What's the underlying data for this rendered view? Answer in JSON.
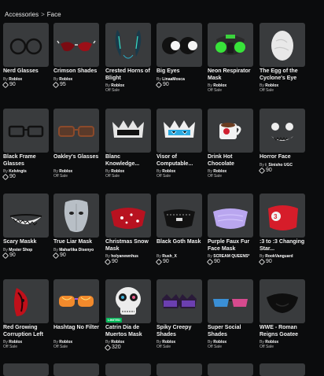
{
  "breadcrumb": {
    "parent": "Accessories",
    "separator": ">",
    "current": "Face"
  },
  "items": [
    {
      "name": "Nerd Glasses",
      "by_prefix": "By",
      "creator": "Roblox",
      "price": "90",
      "icon": "glasses-icon"
    },
    {
      "name": "Crimson Shades",
      "by_prefix": "By",
      "creator": "Roblox",
      "price": "95",
      "icon": "crimson-shades-icon"
    },
    {
      "name": "Crested Horns of Blight",
      "by_prefix": "By",
      "creator": "Roblox",
      "status": "Off Sale",
      "icon": "horns-icon"
    },
    {
      "name": "Big Eyes",
      "by_prefix": "By",
      "creator": "LinaaMosca",
      "price": "90",
      "icon": "big-eyes-icon"
    },
    {
      "name": "Neon Respirator Mask",
      "by_prefix": "By",
      "creator": "Roblox",
      "status": "Off Sale",
      "icon": "respirator-icon"
    },
    {
      "name": "The Egg of the Cyclone's Eye",
      "by_prefix": "By",
      "creator": "Roblox",
      "status": "Off Sale",
      "icon": "egg-icon"
    },
    {
      "name": "Black Frame Glasses",
      "by_prefix": "By",
      "creator": "Kelvingts",
      "price": "90",
      "icon": "black-frame-glasses-icon"
    },
    {
      "name": "Oakley's Glasses",
      "by_prefix": "By",
      "creator": "Roblox",
      "status": "Off Sale",
      "icon": "oakley-glasses-icon"
    },
    {
      "name": "Blanc Knowledge...",
      "by_prefix": "By",
      "creator": "Roblox",
      "status": "Off Sale",
      "icon": "blanc-visor-icon"
    },
    {
      "name": "Visor of Computable...",
      "by_prefix": "By",
      "creator": "Roblox",
      "status": "Off Sale",
      "icon": "computable-visor-icon"
    },
    {
      "name": "Drink Hot Chocolate",
      "by_prefix": "By",
      "creator": "Roblox",
      "status": "Off Sale",
      "icon": "hot-chocolate-icon"
    },
    {
      "name": "Horror Face",
      "by_prefix": "By",
      "creator": "i_Sinisho UGC",
      "price": "90",
      "icon": "horror-face-icon"
    },
    {
      "name": "Scary Maskk",
      "by_prefix": "By",
      "creator": "Myster Shop",
      "price": "90",
      "icon": "scary-mask-icon"
    },
    {
      "name": "True Liar Mask",
      "by_prefix": "By",
      "creator": "Maharlika Disenyo",
      "price": "90",
      "icon": "liar-mask-icon"
    },
    {
      "name": "Christmas Snow Mask",
      "by_prefix": "By",
      "creator": "holyanewnhus",
      "price": "90",
      "icon": "snow-mask-icon"
    },
    {
      "name": "Black Goth Mask",
      "by_prefix": "By",
      "creator": "Rush_X",
      "price": "90",
      "icon": "goth-mask-icon"
    },
    {
      "name": "Purple Faux Fur Face Mask",
      "by_prefix": "By",
      "creator": "SCREAM QUEENS*",
      "price": "90",
      "icon": "purple-mask-icon"
    },
    {
      "name": ":3 to :3 Changing Star...",
      "by_prefix": "By",
      "creator": "RookVanguard",
      "price": "90",
      "icon": "star-mask-icon"
    },
    {
      "name": "Red Growing Corruption Left",
      "by_prefix": "By",
      "creator": "Roblox",
      "status": "Off Sale",
      "icon": "corruption-icon"
    },
    {
      "name": "Hashtag No Filter",
      "by_prefix": "By",
      "creator": "Roblox",
      "status": "Off Sale",
      "icon": "hashtag-glasses-icon"
    },
    {
      "name": "Catrin Dia de Muertos Mask",
      "by_prefix": "By",
      "creator": "Roblox",
      "price": "320",
      "badge": "LIMITED",
      "icon": "skull-mask-icon"
    },
    {
      "name": "Spiky Creepy Shades",
      "by_prefix": "By",
      "creator": "Roblox",
      "status": "Off Sale",
      "icon": "spiky-shades-icon"
    },
    {
      "name": "Super Social Shades",
      "by_prefix": "By",
      "creator": "Roblox",
      "status": "Off Sale",
      "icon": "social-shades-icon"
    },
    {
      "name": "WWE - Roman Reigns Goatee",
      "by_prefix": "By",
      "creator": "Roblox",
      "status": "Off Sale",
      "icon": "goatee-icon"
    }
  ]
}
